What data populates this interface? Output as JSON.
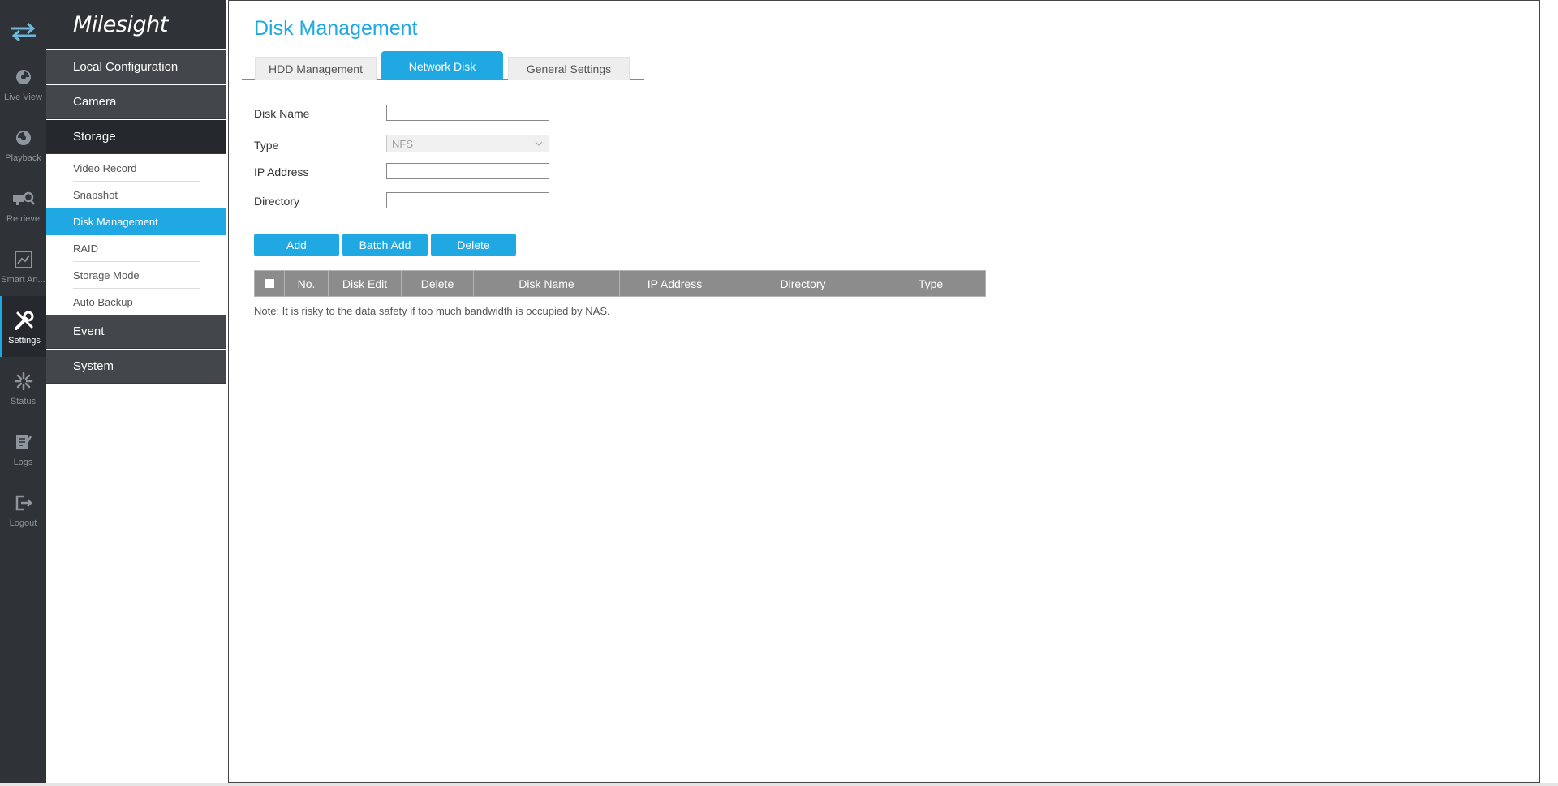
{
  "brand": {
    "logo_text": "Milesight"
  },
  "rail": {
    "items": [
      {
        "label": "Live View",
        "icon": "live-view-icon"
      },
      {
        "label": "Playback",
        "icon": "playback-icon"
      },
      {
        "label": "Retrieve",
        "icon": "retrieve-icon"
      },
      {
        "label": "Smart An...",
        "icon": "smart-analysis-icon"
      },
      {
        "label": "Settings",
        "icon": "settings-icon",
        "active": true
      },
      {
        "label": "Status",
        "icon": "status-icon"
      },
      {
        "label": "Logs",
        "icon": "logs-icon"
      },
      {
        "label": "Logout",
        "icon": "logout-icon"
      }
    ]
  },
  "sidebar": {
    "local_configuration": "Local Configuration",
    "camera": "Camera",
    "storage": "Storage",
    "sub_items": [
      "Video Record",
      "Snapshot",
      "Disk Management",
      "RAID",
      "Storage Mode",
      "Auto Backup"
    ],
    "active_sub": "Disk Management",
    "event": "Event",
    "system": "System"
  },
  "page": {
    "title": "Disk Management",
    "tabs": [
      "HDD Management",
      "Network Disk",
      "General Settings"
    ],
    "active_tab": "Network Disk"
  },
  "form": {
    "disk_name_label": "Disk Name",
    "disk_name_value": "",
    "type_label": "Type",
    "type_value": "NFS",
    "ip_address_label": "IP Address",
    "ip_address_value": "",
    "directory_label": "Directory",
    "directory_value": ""
  },
  "buttons": {
    "add": "Add",
    "batch_add": "Batch Add",
    "delete": "Delete"
  },
  "table": {
    "columns": [
      "No.",
      "Disk Edit",
      "Delete",
      "Disk Name",
      "IP Address",
      "Directory",
      "Type"
    ],
    "rows": []
  },
  "note": "Note: It is risky to the data safety if too much bandwidth is occupied by NAS.",
  "colors": {
    "accent": "#1fa8e2",
    "rail_bg": "#2f3236",
    "menu_bg": "#43464b",
    "menu_active_bg": "#25282c",
    "header_grey": "#8c8c8c"
  }
}
